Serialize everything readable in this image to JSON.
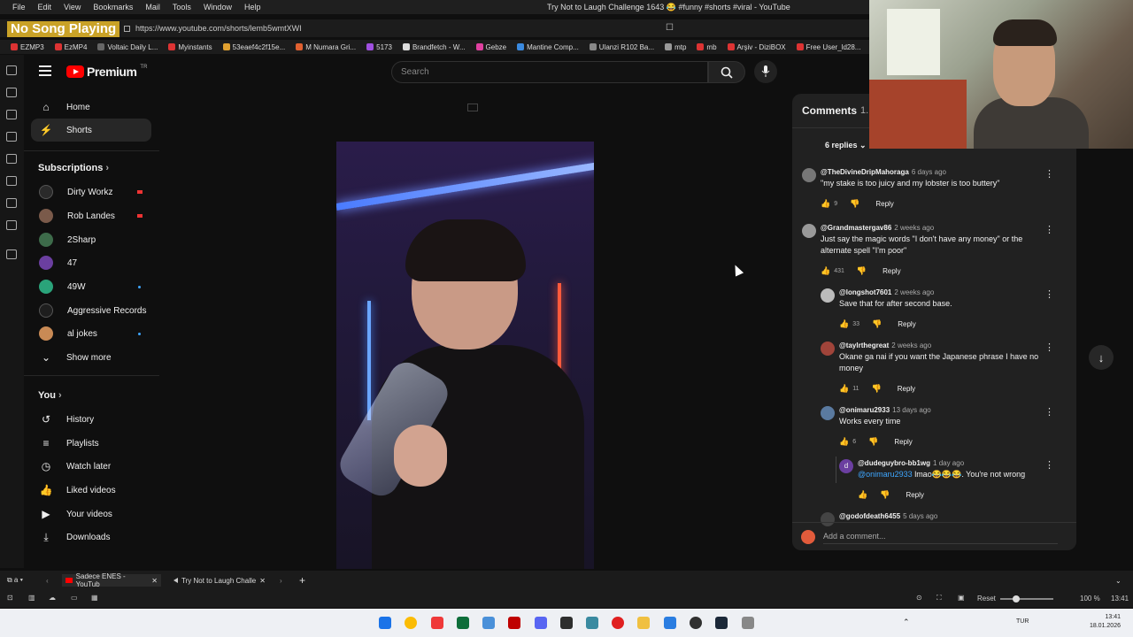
{
  "os_menu": [
    "File",
    "Edit",
    "View",
    "Bookmarks",
    "Mail",
    "Tools",
    "Window",
    "Help"
  ],
  "window_title": "Try Not to Laugh Challenge 1643 😂 #funny #shorts #viral - YouTube",
  "song_badge": "No Song Playing",
  "url": "https://www.youtube.com/shorts/lemb5wmtXWI",
  "bookmarks": [
    "EZMP3",
    "EzMP4",
    "Voltaic Daily L...",
    "Myinstants",
    "53eaef4c2f15e...",
    "M Numara Gri...",
    "5173",
    "Brandfetch - W...",
    "Gebze",
    "Mantine Comp...",
    "Ulanzi R102 Ba...",
    "mtp",
    "mb",
    "Arşiv - DiziBOX",
    "Free User_ld28..."
  ],
  "logo": {
    "text": "Premium",
    "region": "TR"
  },
  "search": {
    "placeholder": "Search"
  },
  "sidebar": {
    "home": "Home",
    "shorts": "Shorts",
    "subscriptions_title": "Subscriptions",
    "subscriptions": [
      {
        "name": "Dirty Workz",
        "status": "live",
        "color": "#2a2a2a"
      },
      {
        "name": "Rob Landes",
        "status": "live",
        "color": "#7a5a4a"
      },
      {
        "name": "2Sharp",
        "status": "",
        "color": "#3d6b4a"
      },
      {
        "name": "47",
        "status": "",
        "color": "#6b3fa0"
      },
      {
        "name": "49W",
        "status": "new",
        "color": "#2aa37a"
      },
      {
        "name": "Aggressive Records",
        "status": "",
        "color": "#1e1e1e"
      },
      {
        "name": "al jokes",
        "status": "new",
        "color": "#c98a55"
      }
    ],
    "show_more": "Show more",
    "you_title": "You",
    "you_items": [
      "History",
      "Playlists",
      "Watch later",
      "Liked videos",
      "Your videos",
      "Downloads"
    ]
  },
  "comments": {
    "title": "Comments",
    "count": "1.",
    "replies_toggle": "6 replies",
    "items": [
      {
        "author": "@TheDivineDripMahoraga",
        "time": "6 days ago",
        "text": "\"my stake is too juicy and my lobster is too buttery\"",
        "likes": "9",
        "reply": "Reply",
        "color": "#777"
      },
      {
        "author": "@Grandmastergav86",
        "time": "2 weeks ago",
        "text": "Just say the magic words \"I don't have any money\" or the alternate spell \"I'm poor\"",
        "likes": "431",
        "reply": "Reply",
        "color": "#999"
      },
      {
        "author": "@longshot7601",
        "time": "2 weeks ago",
        "text": "Save that for after second base.",
        "likes": "33",
        "reply": "Reply",
        "color": "#bbb"
      },
      {
        "author": "@taylrthegreat",
        "time": "2 weeks ago",
        "text": "Okane ga nai if you want the Japanese phrase I have no money",
        "likes": "11",
        "reply": "Reply",
        "color": "#a0443a"
      },
      {
        "author": "@onimaru2933",
        "time": "13 days ago",
        "text": "Works every time",
        "likes": "6",
        "reply": "Reply",
        "color": "#5a7aa0"
      },
      {
        "author": "@dudeguybro-bb1wg",
        "time": "1 day ago",
        "mention": "@onimaru2933",
        "text": " lmao😂😂😂. You're not wrong",
        "likes": "",
        "reply": "Reply",
        "color": "#6b3fa0",
        "initial": "d"
      },
      {
        "author": "@godofdeath6455",
        "time": "5 days ago"
      }
    ],
    "add_placeholder": "Add a comment..."
  },
  "tabs": [
    {
      "label": "Sadece ENES - YouTub"
    },
    {
      "label": "Try Not to Laugh Challe"
    }
  ],
  "status": {
    "reset": "Reset",
    "zoom": "100 %",
    "time": "13:41"
  },
  "taskbar": {
    "lang": "TUR",
    "time": "13:41",
    "date": "18.01.2026"
  }
}
